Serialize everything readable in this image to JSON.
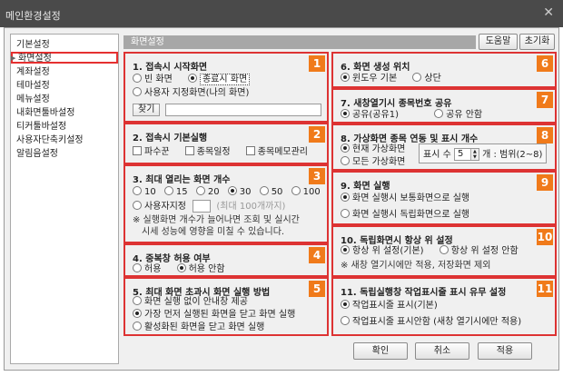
{
  "window": {
    "title": "메인환경설정",
    "close": "✕"
  },
  "sidebar": {
    "items": [
      "기본설정",
      "화면설정",
      "계좌설정",
      "테마설정",
      "메뉴설정",
      "내화면툴바설정",
      "티커툴바설정",
      "사용자단축키설정",
      "알림음설정"
    ],
    "selected_index": 1
  },
  "header": {
    "title": "화면설정",
    "help": "도움말",
    "reset": "초기화"
  },
  "sections": {
    "s1": {
      "badge": "1",
      "title": "1. 접속시 시작화면",
      "opt_blank": "빈 화면",
      "opt_last": "종료시 화면",
      "opt_user": "사용자 지정화면(나의 화면)",
      "find": "찾기"
    },
    "s2": {
      "badge": "2",
      "title": "2. 접속시 기본실행",
      "c1": "파수꾼",
      "c2": "종목일정",
      "c3": "종목메모관리"
    },
    "s3": {
      "badge": "3",
      "title": "3. 최대 열리는 화면 개수",
      "counts": [
        "10",
        "15",
        "20",
        "30",
        "50",
        "100"
      ],
      "selected": "30",
      "user": "사용자지정",
      "max_hint": "(최대 100개까지)",
      "note1": "※ 실행화면 개수가 늘어나면 조회 및 실시간",
      "note2": "시세 성능에 영향을 미칠 수 있습니다."
    },
    "s4": {
      "badge": "4",
      "title": "4. 중복창 허용 여부",
      "allow": "허용",
      "deny": "허용 안함"
    },
    "s5": {
      "badge": "5",
      "title": "5. 최대 화면 초과시 화면 실행 방법",
      "o1": "화면 실행 없이 안내창 제공",
      "o2": "가장 먼저 실행된 화면을 닫고 화면 실행",
      "o3": "활성화된 화면을 닫고 화면 실행"
    },
    "s6": {
      "badge": "6",
      "title": "6. 화면 생성 위치",
      "o1": "윈도우 기본",
      "o2": "상단"
    },
    "s7": {
      "badge": "7",
      "title": "7. 새창열기시 종목번호 공유",
      "o1": "공유(공유1)",
      "o2": "공유 안함"
    },
    "s8": {
      "badge": "8",
      "title": "8. 가상화면 종목 연동 및 표시 개수",
      "o1": "현재 가상화면",
      "o2": "모든 가상화면",
      "count_label": "표시 수",
      "count_value": "5",
      "range": "개 : 범위(2~8)"
    },
    "s9": {
      "badge": "9",
      "title": "9. 화면 실행",
      "o1": "화면 실행시 보통화면으로 실행",
      "o2": "화면 실행시 독립화면으로 실행"
    },
    "s10": {
      "badge": "10",
      "title": "10. 독립화면시 항상 위 설정",
      "o1": "항상 위 설정(기본)",
      "o2": "항상 위 설정 안함",
      "note": "※ 새창 열기시에만 적용, 저장화면 제외"
    },
    "s11": {
      "badge": "11",
      "title": "11. 독립실행창 작업표시줄 표시 유무 설정",
      "o1": "작업표시줄 표시(기본)",
      "o2": "작업표시줄 표시안함 (새창 열기시에만 적용)"
    }
  },
  "footer": {
    "ok": "확인",
    "cancel": "취소",
    "apply": "적용"
  }
}
